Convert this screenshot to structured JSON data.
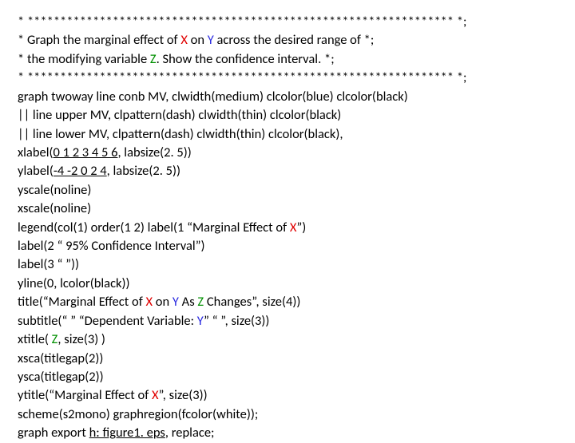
{
  "lines": [
    {
      "text": "* ***************************************************************** *;"
    },
    {
      "segments": [
        {
          "t": "* Graph the marginal effect of "
        },
        {
          "t": "X",
          "cls": "v-x"
        },
        {
          "t": " on "
        },
        {
          "t": "Y",
          "cls": "v-y"
        },
        {
          "t": " across the desired range of *;"
        }
      ]
    },
    {
      "segments": [
        {
          "t": "* the modifying variable "
        },
        {
          "t": "Z",
          "cls": "v-z"
        },
        {
          "t": ". Show the confidence interval. *;"
        }
      ]
    },
    {
      "text": "* ***************************************************************** *;"
    },
    {
      "text": "graph twoway line conb MV, clwidth(medium) clcolor(blue) clcolor(black)"
    },
    {
      "text": "|| line upper MV, clpattern(dash) clwidth(thin) clcolor(black)"
    },
    {
      "text": "|| line lower MV, clpattern(dash) clwidth(thin) clcolor(black),"
    },
    {
      "segments": [
        {
          "t": "xlabel("
        },
        {
          "t": "0 1 2 3 4 5 6",
          "cls": "underline"
        },
        {
          "t": ", labsize(2. 5))"
        }
      ]
    },
    {
      "segments": [
        {
          "t": "ylabel("
        },
        {
          "t": "-4 -2 0 2 4",
          "cls": "underline"
        },
        {
          "t": ", labsize(2. 5))"
        }
      ]
    },
    {
      "text": "yscale(noline)"
    },
    {
      "text": "xscale(noline)"
    },
    {
      "segments": [
        {
          "t": "legend(col(1) order(1 2) label(1 “Marginal Effect of "
        },
        {
          "t": "X",
          "cls": "v-x"
        },
        {
          "t": "”)"
        }
      ]
    },
    {
      "text": "label(2 “ 95% Confidence Interval”)"
    },
    {
      "text": "label(3 “ ”))"
    },
    {
      "text": "yline(0, lcolor(black))"
    },
    {
      "segments": [
        {
          "t": "title(“Marginal Effect of "
        },
        {
          "t": "X",
          "cls": "v-x"
        },
        {
          "t": " on "
        },
        {
          "t": "Y",
          "cls": "v-y"
        },
        {
          "t": " As "
        },
        {
          "t": "Z",
          "cls": "v-z"
        },
        {
          "t": " Changes”, size(4))"
        }
      ]
    },
    {
      "segments": [
        {
          "t": "subtitle(“ ” “Dependent Variable: "
        },
        {
          "t": "Y",
          "cls": "v-y"
        },
        {
          "t": "” “ ”, size(3))"
        }
      ]
    },
    {
      "segments": [
        {
          "t": "xtitle( "
        },
        {
          "t": "Z",
          "cls": "v-z"
        },
        {
          "t": ", size(3) )"
        }
      ]
    },
    {
      "text": "xsca(titlegap(2))"
    },
    {
      "text": "ysca(titlegap(2))"
    },
    {
      "segments": [
        {
          "t": "ytitle(“Marginal Effect of "
        },
        {
          "t": "X",
          "cls": "v-x"
        },
        {
          "t": "”, size(3))"
        }
      ]
    },
    {
      "text": "scheme(s2mono) graphregion(fcolor(white));"
    },
    {
      "segments": [
        {
          "t": "graph export "
        },
        {
          "t": "h: figure1. eps",
          "cls": "underline"
        },
        {
          "t": ", replace;"
        }
      ]
    }
  ]
}
